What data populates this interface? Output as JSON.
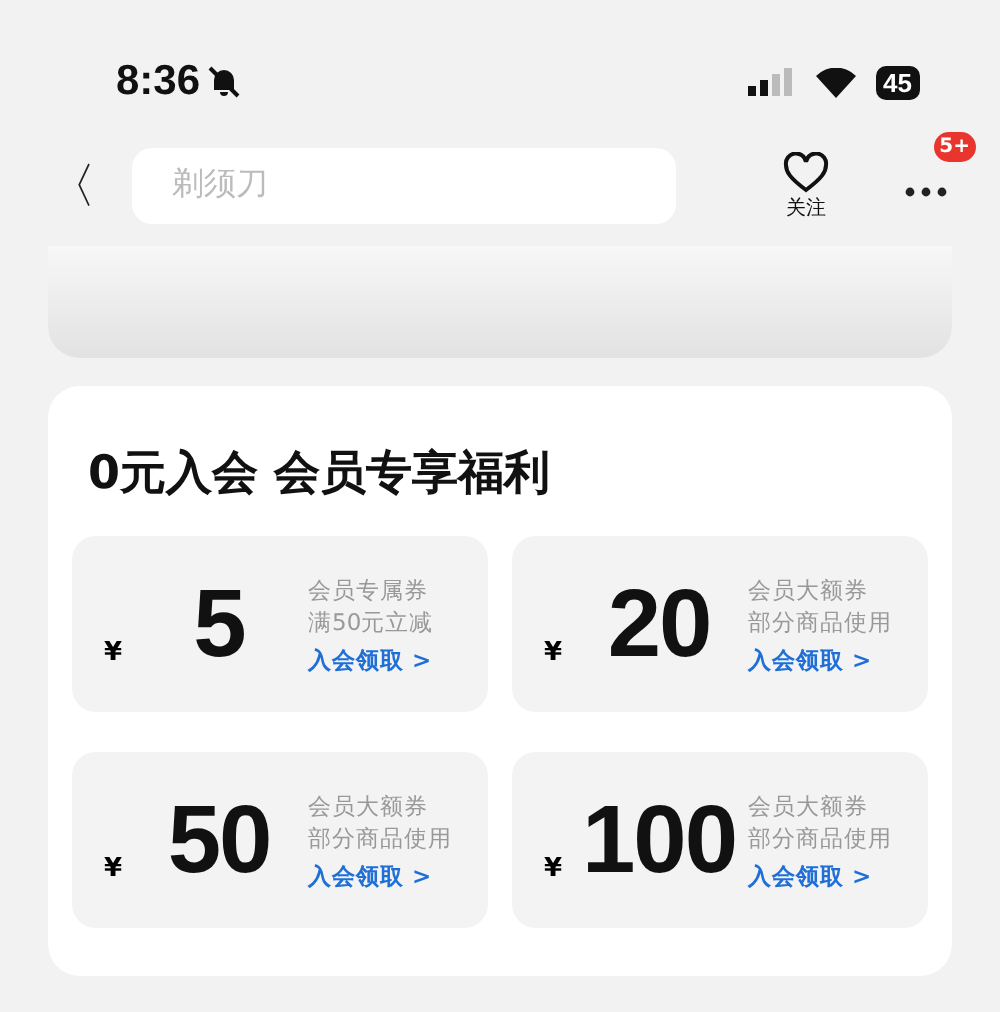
{
  "status_bar": {
    "time": "8:36",
    "muted": true,
    "battery": "45"
  },
  "nav": {
    "back": "〈",
    "search": {
      "placeholder": "剃须刀"
    },
    "follow": {
      "label": "关注"
    },
    "more": {
      "badge": "5+"
    }
  },
  "membership": {
    "title": "0元入会 会员专享福利",
    "coupons": [
      {
        "currency": "¥",
        "amount": "5",
        "line1": "会员专属券",
        "line2": "满50元立减",
        "link": "入会领取 >"
      },
      {
        "currency": "¥",
        "amount": "20",
        "line1": "会员大额券",
        "line2": "部分商品使用",
        "link": "入会领取 >"
      },
      {
        "currency": "¥",
        "amount": "50",
        "line1": "会员大额券",
        "line2": "部分商品使用",
        "link": "入会领取 >"
      },
      {
        "currency": "¥",
        "amount": "100",
        "line1": "会员大额券",
        "line2": "部分商品使用",
        "link": "入会领取 >"
      }
    ]
  }
}
